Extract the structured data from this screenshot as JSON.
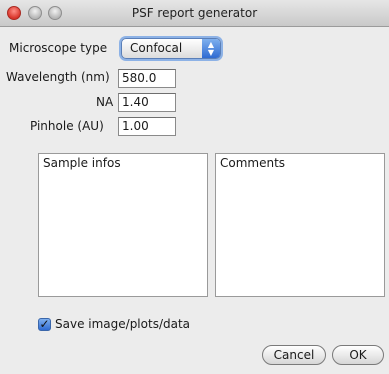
{
  "window": {
    "title": "PSF report generator"
  },
  "form": {
    "microscope_type": {
      "label": "Microscope type",
      "value": "Confocal"
    },
    "wavelength": {
      "label": "Wavelength (nm)",
      "value": "580.0"
    },
    "na": {
      "label": "NA",
      "value": "1.40"
    },
    "pinhole": {
      "label": "Pinhole (AU)",
      "value": "1.00"
    }
  },
  "panels": {
    "sample_infos": {
      "label": "Sample infos",
      "value": ""
    },
    "comments": {
      "label": "Comments",
      "value": ""
    }
  },
  "options": {
    "save_checkbox": {
      "label": "Save image/plots/data",
      "checked": true
    }
  },
  "buttons": {
    "cancel": "Cancel",
    "ok": "OK"
  },
  "colors": {
    "accent": "#2f6bd2",
    "focus_ring": "#8db2e6",
    "close_button": "#d9352b"
  }
}
